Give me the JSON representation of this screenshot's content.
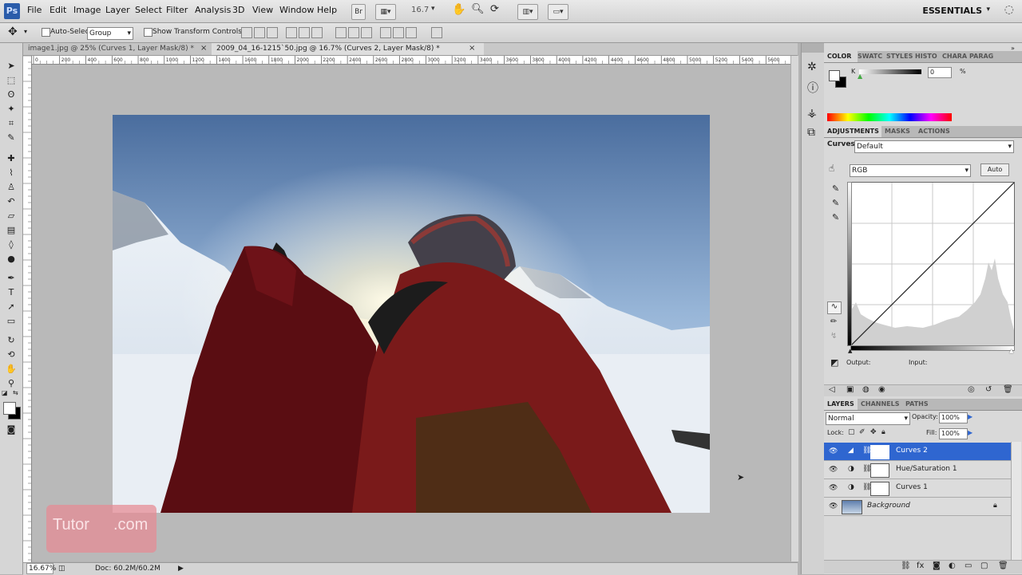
{
  "app": {
    "logo": "Ps",
    "workspace": "ESSENTIALS"
  },
  "menu": [
    "File",
    "Edit",
    "Image",
    "Layer",
    "Select",
    "Filter",
    "Analysis",
    "3D",
    "View",
    "Window",
    "Help"
  ],
  "menubar_zoom": "16.7",
  "options": {
    "auto_select_label": "Auto-Select:",
    "auto_select_value": "Group",
    "show_transform_label": "Show Transform Controls"
  },
  "tabs": [
    {
      "label": "image1.jpg @ 25% (Curves 1, Layer Mask/8) *"
    },
    {
      "label": "2009_04_16-1215`50.jpg @ 16.7% (Curves 2, Layer Mask/8) *"
    }
  ],
  "ruler_h": [
    "0",
    "200",
    "400",
    "600",
    "800",
    "1000",
    "1200",
    "1400",
    "1600",
    "1800",
    "2000",
    "2200",
    "2400",
    "2600",
    "2800",
    "3000",
    "3200",
    "3400",
    "3600",
    "3800",
    "4000",
    "4200",
    "4400",
    "4600",
    "4800",
    "5000",
    "5200",
    "5400",
    "5600"
  ],
  "status": {
    "zoom": "16.67%",
    "doc": "Doc: 60.2M/60.2M"
  },
  "watermark": "Tutor",
  "watermark_tail": ".com",
  "color_panel": {
    "tabs": [
      "COLOR",
      "SWATC",
      "STYLES",
      "HISTO",
      "CHARA",
      "PARAG"
    ],
    "channel": "K",
    "value": "0",
    "unit": "%"
  },
  "adjustments": {
    "tabs": [
      "ADJUSTMENTS",
      "MASKS",
      "ACTIONS"
    ],
    "type_label": "Curves",
    "preset": "Default",
    "channel": "RGB",
    "auto_label": "Auto",
    "output_label": "Output:",
    "input_label": "Input:"
  },
  "layers": {
    "tabs": [
      "LAYERS",
      "CHANNELS",
      "PATHS"
    ],
    "blend_mode": "Normal",
    "opacity_label": "Opacity:",
    "opacity": "100%",
    "lock_label": "Lock:",
    "fill_label": "Fill:",
    "fill": "100%",
    "items": [
      {
        "name": "Curves 2",
        "selected": true
      },
      {
        "name": "Hue/Saturation 1",
        "selected": false
      },
      {
        "name": "Curves 1",
        "selected": false
      },
      {
        "name": "Background",
        "selected": false
      }
    ]
  }
}
